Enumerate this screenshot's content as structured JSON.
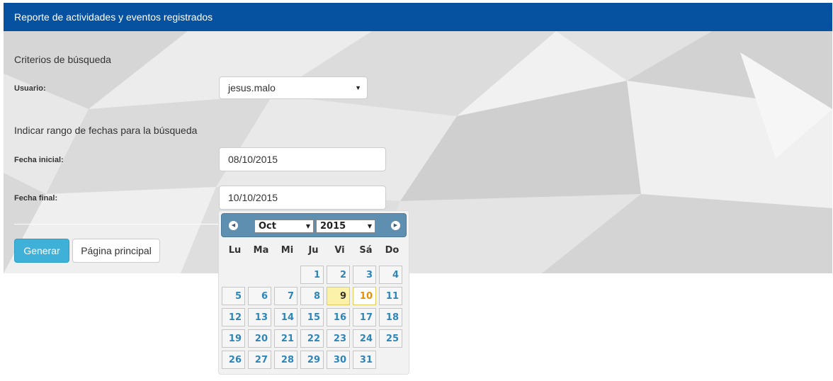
{
  "header": {
    "title": "Reporte de actividades y eventos registrados"
  },
  "form": {
    "criteria_title": "Criterios de búsqueda",
    "user_label": "Usuario:",
    "user_value": "jesus.malo",
    "range_title": "Indicar rango de fechas para la búsqueda",
    "start_label": "Fecha inicial:",
    "start_value": "08/10/2015",
    "end_label": "Fecha final:",
    "end_value": "10/10/2015",
    "generate_button": "Generar",
    "home_button": "Página principal"
  },
  "datepicker": {
    "month": "Oct",
    "year": "2015",
    "weekdays": [
      "Lu",
      "Ma",
      "Mi",
      "Ju",
      "Vi",
      "Sá",
      "Do"
    ],
    "days": [
      "1",
      "2",
      "3",
      "4",
      "5",
      "6",
      "7",
      "8",
      "9",
      "10",
      "11",
      "12",
      "13",
      "14",
      "15",
      "16",
      "17",
      "18",
      "19",
      "20",
      "21",
      "22",
      "23",
      "24",
      "25",
      "26",
      "27",
      "28",
      "29",
      "30",
      "31"
    ],
    "today": "9",
    "selected": "10",
    "colors": {
      "header": "#5f8fb0",
      "day_link": "#2e86b8",
      "today_bg": "#fcf1a9",
      "selected_text": "#eb8f00"
    }
  },
  "colors": {
    "header_bar": "#0652a0",
    "primary_button": "#3fb0d8"
  }
}
